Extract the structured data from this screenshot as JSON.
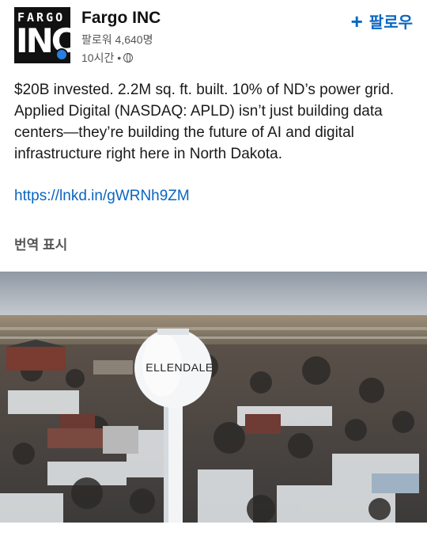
{
  "author": {
    "logo_line1": "FARGO",
    "logo_line2": "INC!",
    "name": "Fargo INC",
    "followers": "팔로워 4,640명",
    "time": "10시간 •"
  },
  "follow": {
    "label": "팔로우",
    "icon": "plus-icon"
  },
  "post": {
    "text": "$20B invested. 2.2M sq. ft. built. 10% of ND’s power grid. Applied Digital (NASDAQ: APLD) isn’t just building data centers—they’re building the future of AI and digital infrastructure right here in North Dakota.",
    "link": "https://lnkd.in/gWRNh9ZM",
    "translate": "번역 표시"
  },
  "image": {
    "tower_text": "ELLENDALE"
  },
  "colors": {
    "accent": "#0a66c2",
    "badge": "#2a7de1"
  }
}
